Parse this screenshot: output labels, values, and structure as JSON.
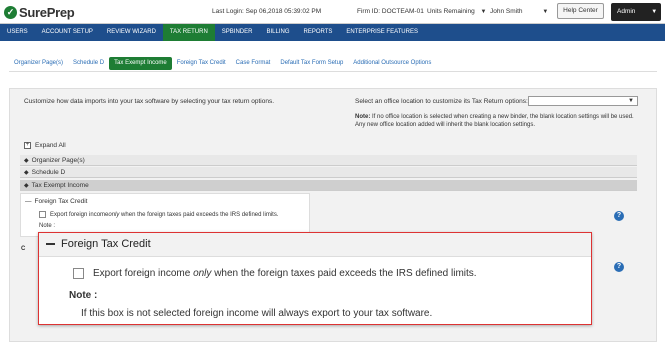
{
  "header": {
    "logo_check": "✓",
    "logo_text": "SurePrep",
    "last_login": "Last Login: Sep 06,2018 05:39:02 PM",
    "firm_id": "Firm ID: DOCTEAM-01",
    "units": "Units Remaining",
    "user": "John Smith",
    "help": "Help Center",
    "admin": "Admin"
  },
  "nav": {
    "items": [
      "USERS",
      "ACCOUNT SETUP",
      "REVIEW WIZARD",
      "TAX RETURN",
      "SPBINDER",
      "BILLING",
      "REPORTS",
      "ENTERPRISE FEATURES"
    ],
    "active": "TAX RETURN"
  },
  "subtabs": {
    "items": [
      "Organizer Page(s)",
      "Schedule D",
      "Tax Exempt Income",
      "Foreign Tax Credit",
      "Case Format",
      "Default Tax Form Setup",
      "Additional Outsource Options"
    ],
    "active": "Tax Exempt Income"
  },
  "content": {
    "intro": "Customize how data imports into your tax software by selecting your tax return options.",
    "office_label": "Select an office location to customize its Tax Return options:",
    "note_label": "Note:",
    "note_text": " If no office location is selected when creating a new binder, the blank location settings will be used. Any new office location added will inherit the blank location settings.",
    "expand_all": "Expand All",
    "sections": [
      "Organizer Page(s)",
      "Schedule D",
      "Tax Exempt Income"
    ],
    "small_panel": {
      "title": "Foreign Tax Credit",
      "checkbox_pre": "Export foreign income ",
      "checkbox_em": "only",
      "checkbox_post": " when the foreign taxes paid exceeds the IRS defined limits.",
      "note": "Note :"
    },
    "side_mark": "C"
  },
  "zoom": {
    "title": "Foreign Tax Credit",
    "checkbox_pre": "Export foreign income ",
    "checkbox_em": "only",
    "checkbox_post": " when the foreign taxes paid exceeds the IRS defined limits.",
    "note_label": "Note :",
    "note_text": "If this box is not selected foreign income will always export to your tax software."
  },
  "icons": {
    "help": "?",
    "caret": "▼",
    "diamond": "◆"
  },
  "colors": {
    "nav_bg": "#1e4e8c",
    "active_green": "#1e7d34",
    "zoom_border": "#dd3333"
  }
}
